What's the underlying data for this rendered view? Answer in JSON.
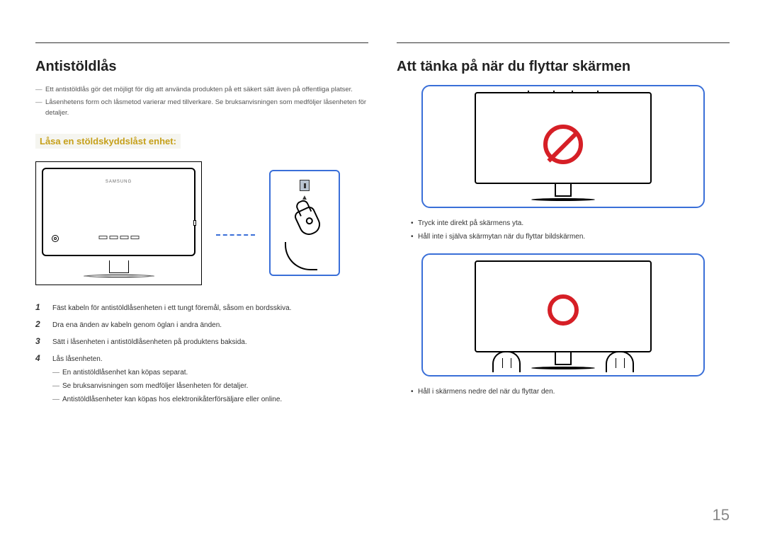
{
  "left": {
    "heading": "Antistöldlås",
    "intro": [
      "Ett antistöldlås gör det möjligt för dig att använda produkten på ett säkert sätt även på offentliga platser.",
      "Låsenhetens form och låsmetod varierar med tillverkare. Se bruksanvisningen som medföljer låsenheten för detaljer."
    ],
    "subheading": "Låsa en stöldskyddslåst enhet:",
    "brand": "SAMSUNG",
    "steps": [
      "Fäst kabeln för antistöldlåsenheten i ett tungt föremål, såsom en bordsskiva.",
      "Dra ena änden av kabeln genom öglan i andra änden.",
      "Sätt i låsenheten i antistöldlåsenheten på produktens baksida.",
      "Lås låsenheten."
    ],
    "notes": [
      "En antistöldlåsenhet kan köpas separat.",
      "Se bruksanvisningen som medföljer låsenheten för detaljer.",
      "Antistöldlåsenheter kan köpas hos elektronikåterförsäljare eller online."
    ]
  },
  "right": {
    "heading": "Att tänka på när du flyttar skärmen",
    "bullets1": [
      "Tryck inte direkt på skärmens yta.",
      "Håll inte i själva skärmytan när du flyttar bildskärmen."
    ],
    "bullets2": [
      "Håll i skärmens nedre del när du flyttar den."
    ]
  },
  "page_number": "15"
}
